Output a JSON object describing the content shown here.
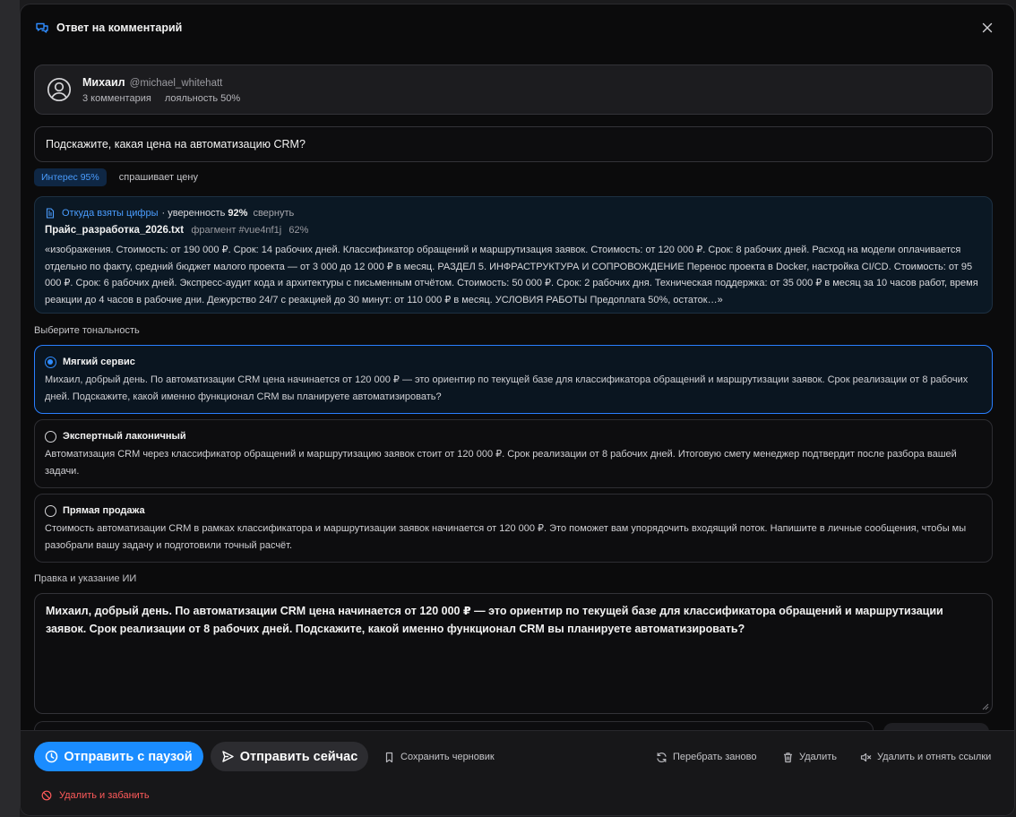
{
  "modal": {
    "title": "Ответ на комментарий"
  },
  "user": {
    "name": "Михаил",
    "handle": "@michael_whitehatt",
    "comments": "3 комментария",
    "loyalty": "лояльность 50%"
  },
  "comment": {
    "text": "Подскажите, какая цена на автоматизацию CRM?"
  },
  "tags": {
    "interest": "Интерес 95%",
    "intent": "спрашивает цену"
  },
  "source": {
    "link_label": "Откуда взяты цифры",
    "confidence_prefix": "· уверенность",
    "confidence_value": "92%",
    "collapse_label": "свернуть",
    "file_name": "Прайс_разработка_2026.txt",
    "fragment": "фрагмент #vue4nf1j",
    "match": "62%",
    "excerpt": "«изображения. Стоимость: от 190 000 ₽. Срок: 14 рабочих дней. Классификатор обращений и маршрутизация заявок. Стоимость: от 120 000 ₽. Срок: 8 рабочих дней. Расход на модели оплачивается отдельно по факту, средний бюджет малого проекта — от 3 000 до 12 000 ₽ в месяц. РАЗДЕЛ 5. ИНФРАСТРУКТУРА И СОПРОВОЖДЕНИЕ Перенос проекта в Docker, настройка CI/CD. Стоимость: от 95 000 ₽. Срок: 6 рабочих дней. Экспресс-аудит кода и архитектуры с письменным отчётом. Стоимость: 50 000 ₽. Срок: 2 рабочих дня. Техническая поддержка: от 35 000 ₽ в месяц за 10 часов работ, время реакции до 4 часов в рабочие дни. Дежурство 24/7 с реакцией до 30 минут: от 110 000 ₽ в месяц. УСЛОВИЯ РАБОТЫ Предоплата 50%, остаток…»"
  },
  "tone": {
    "label": "Выберите тональность",
    "options": [
      {
        "name": "Мягкий сервис",
        "text": "Михаил, добрый день. По автоматизации CRM цена начинается от 120 000 ₽ — это ориентир по текущей базе для классификатора обращений и маршрутизации заявок. Срок реализации от 8 рабочих дней. Подскажите, какой именно функционал CRM вы планируете автоматизировать?",
        "selected": true
      },
      {
        "name": "Экспертный лаконичный",
        "text": "Автоматизация CRM через классификатор обращений и маршрутизацию заявок стоит от 120 000 ₽. Срок реализации от 8 рабочих дней. Итоговую смету менеджер подтвердит после разбора вашей задачи.",
        "selected": false
      },
      {
        "name": "Прямая продажа",
        "text": "Стоимость автоматизации CRM в рамках классификатора и маршрутизации заявок начинается от 120 000 ₽. Это поможет вам упорядочить входящий поток. Напишите в личные сообщения, чтобы мы разобрали вашу задачу и подготовили точный расчёт.",
        "selected": false
      }
    ]
  },
  "editor": {
    "label": "Правка и указание ИИ",
    "text": "Михаил, добрый день. По автоматизации CRM цена начинается от 120 000 ₽ — это ориентир по текущей базе для классификатора обращений и маршрутизации заявок. Срок реализации от 8 рабочих дней. Подскажите, какой именно функционал CRM вы планируете автоматизировать?"
  },
  "footer": {
    "send_delayed": "Отправить с паузой",
    "send_now": "Отправить сейчас",
    "save_draft": "Сохранить черновик",
    "regenerate": "Перебрать заново",
    "delete": "Удалить",
    "delete_revoke": "Удалить и отнять ссылки",
    "delete_ban": "Удалить и забанить"
  },
  "colors": {
    "accent": "#1a8cff",
    "danger": "#ff5a5a",
    "background": "#0b0b0c"
  }
}
